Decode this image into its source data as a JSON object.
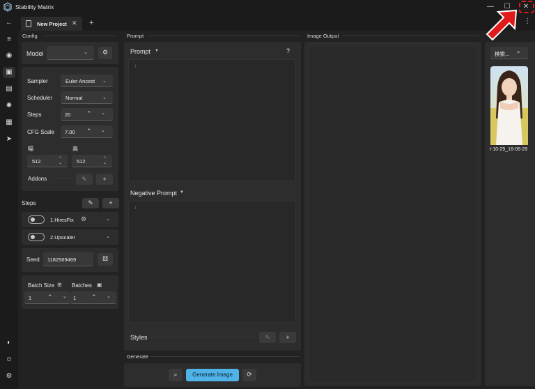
{
  "window": {
    "title": "Stability Matrix"
  },
  "tabs": [
    {
      "label": "New Project"
    }
  ],
  "panels": {
    "config": "Config",
    "prompt": "Prompt",
    "image_output": "Image Output",
    "generate": "Generate"
  },
  "config": {
    "model_label": "Model",
    "model_value": "",
    "sampler_label": "Sampler",
    "sampler_value": "Euler Ancest",
    "scheduler_label": "Scheduler",
    "scheduler_value": "Normal",
    "steps_label": "Steps",
    "steps_value": "20",
    "cfg_label": "CFG Scale",
    "cfg_value": "7.00",
    "width_label": "幅",
    "width_value": "512",
    "height_label": "高",
    "height_value": "512",
    "addons_label": "Addons",
    "steps_section_label": "Steps",
    "step_items": [
      "1.HiresFix",
      "2.Upscaler"
    ],
    "seed_label": "Seed",
    "seed_value": "1182569469",
    "batch_size_label": "Batch Size",
    "batch_size_value": "1",
    "batches_label": "Batches",
    "batches_value": "1"
  },
  "prompt": {
    "prompt_label": "Prompt",
    "help": "?",
    "line_number": "1",
    "negative_label": "Negative Prompt",
    "styles_label": "Styles"
  },
  "generate": {
    "button_label": "Generate Image"
  },
  "gallery": {
    "search_placeholder": "検索...",
    "item_caption": "t-10-29_16-06-28"
  },
  "colors": {
    "accent": "#4fb3e8",
    "annotation": "#e01a1a"
  }
}
